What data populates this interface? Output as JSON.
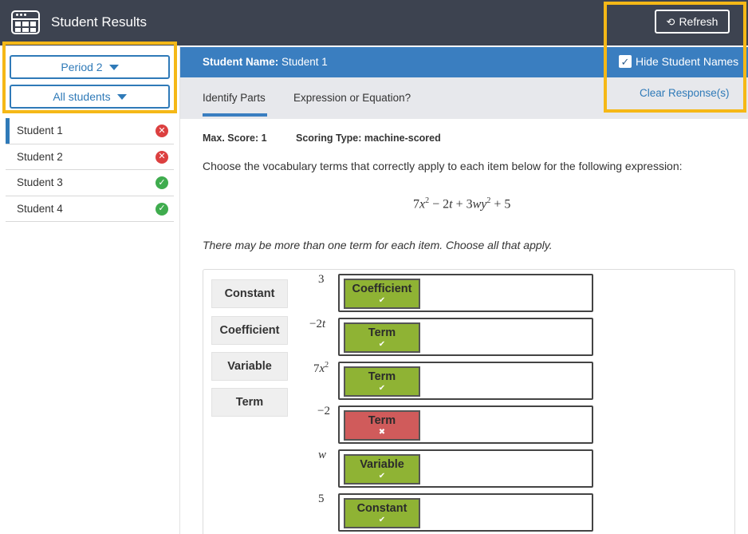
{
  "header": {
    "title": "Student Results",
    "refresh_label": "Refresh",
    "refresh_icon": "⟲"
  },
  "sidebar": {
    "period_label": "Period 2",
    "filter_label": "All students",
    "students": [
      {
        "name": "Student 1",
        "status": "✕"
      },
      {
        "name": "Student 2",
        "status": "✕"
      },
      {
        "name": "Student 3",
        "status": "✓"
      },
      {
        "name": "Student 4",
        "status": "✓"
      }
    ]
  },
  "student_bar": {
    "name_label": "Student Name:",
    "name_value": " Student 1",
    "hide_names_label": "Hide Student Names",
    "hide_names_check": "✓"
  },
  "tabs": {
    "items": [
      "Identify Parts",
      "Expression or Equation?"
    ],
    "clear_label": "Clear Response(s)"
  },
  "question": {
    "max_score": "Max. Score: 1",
    "scoring_type": "Scoring Type: machine-scored",
    "prompt": "Choose the vocabulary terms that correctly apply to each item below for the following expression:",
    "expression": {
      "a": "7",
      "b": "x",
      "c": "2",
      "d": " − 2",
      "e": "t",
      "f": " + 3",
      "g": "wy",
      "h": "2",
      "i": " + 5"
    },
    "instructions": "There may be more than one term for each item. Choose all that apply.",
    "bank": [
      "Constant",
      "Coefficient",
      "Variable",
      "Term"
    ],
    "rows": [
      {
        "label": {
          "n": "3",
          "v": ""
        },
        "answer": "Coefficient",
        "mark": "✔"
      },
      {
        "label": {
          "n": "−2",
          "v": "t"
        },
        "answer": "Term",
        "mark": "✔"
      },
      {
        "label": {
          "n": "7",
          "v": "x",
          "exp": "2"
        },
        "answer": "Term",
        "mark": "✔"
      },
      {
        "label": {
          "n": "−2",
          "v": ""
        },
        "answer": "Term",
        "mark": "✖"
      },
      {
        "label": {
          "n": "",
          "v": "w"
        },
        "answer": "Variable",
        "mark": "✔"
      },
      {
        "label": {
          "n": "5",
          "v": ""
        },
        "answer": "Constant",
        "mark": "✔"
      }
    ]
  },
  "colors": {
    "topbar": "#3d4350",
    "primary": "#3a7ec0",
    "correct": "#8fb334",
    "incorrect": "#d05b5b",
    "highlight": "#f5b817"
  }
}
